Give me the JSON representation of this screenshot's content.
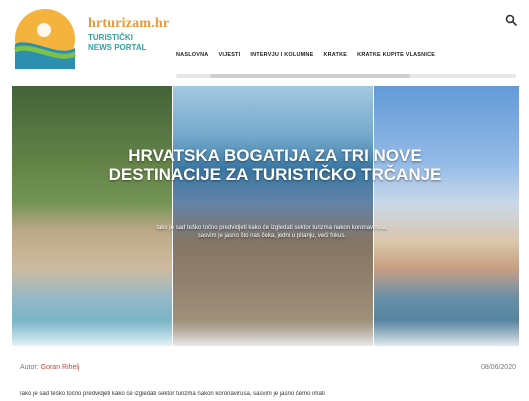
{
  "brand": {
    "name": "hrturizam.hr",
    "subtitle_line1": "TURISTIČKI",
    "subtitle_line2": "NEWS PORTAL"
  },
  "nav": {
    "items": [
      "NASLOVNA",
      "VIJESTI",
      "INTERVJU I KOLUMNE",
      "KRATKE",
      "KRATKE KUPITE VLASNICE"
    ]
  },
  "hero": {
    "title": "HRVATSKA BOGATIJA ZA TRI NOVE DESTINACIJE ZA TURISTIČKO TRČANJE",
    "description": "Iako je sad teško točno predvidjeti kako će izgledati sektor turizma nakon koronavirusa, sasvim je jasno što nas čeka, jedni u pitanju, veći fokus."
  },
  "meta": {
    "author_label": "Autor:",
    "author_name": "Goran Rihelj",
    "date": "08/06/2020"
  },
  "excerpt": "Iako je sad teško točno predvidjeti kako će izgledati sektor turizma nakon koronavirusa, sasvim je jasno čemo imati",
  "colors": {
    "accent": "#e89a3a",
    "teal": "#35a3a0",
    "author": "#c5483f"
  },
  "icons": {
    "search": "search-icon"
  }
}
